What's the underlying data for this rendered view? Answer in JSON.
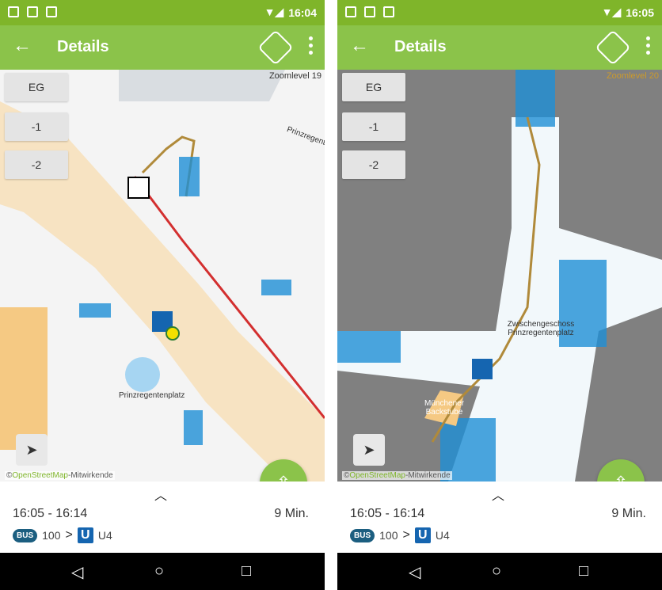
{
  "screens": [
    {
      "status_time": "16:04",
      "title": "Details",
      "zoom_label": "Zoomlevel 19",
      "floors": [
        "EG",
        "-1",
        "-2"
      ],
      "street_label": "Prinzregentenplatz",
      "map_label": "Prinzregentenplatz",
      "osm_link": "OpenStreetMap",
      "osm_rest": "-Mitwirkende",
      "time_range": "16:05 - 16:14",
      "duration": "9 Min.",
      "bus_label": "BUS",
      "bus_line": "100",
      "arrow": ">",
      "u_label": "U",
      "u_line": "U4"
    },
    {
      "status_time": "16:05",
      "title": "Details",
      "zoom_label": "Zoomlevel 20",
      "floors": [
        "EG",
        "-1",
        "-2"
      ],
      "map_label_1": "Zwischengeschoss Prinzregentenplatz",
      "map_label_2": "Münchener Backstube",
      "osm_link": "OpenStreetMap",
      "osm_rest": "-Mitwirkende",
      "time_range": "16:05 - 16:14",
      "duration": "9 Min.",
      "bus_label": "BUS",
      "bus_line": "100",
      "arrow": ">",
      "u_label": "U",
      "u_line": "U4"
    }
  ],
  "colors": {
    "accent": "#8bc34a",
    "status": "#7fb52a",
    "route": "#b08a3a",
    "route_red": "#d32f2f",
    "ubahn": "#1565b0"
  }
}
